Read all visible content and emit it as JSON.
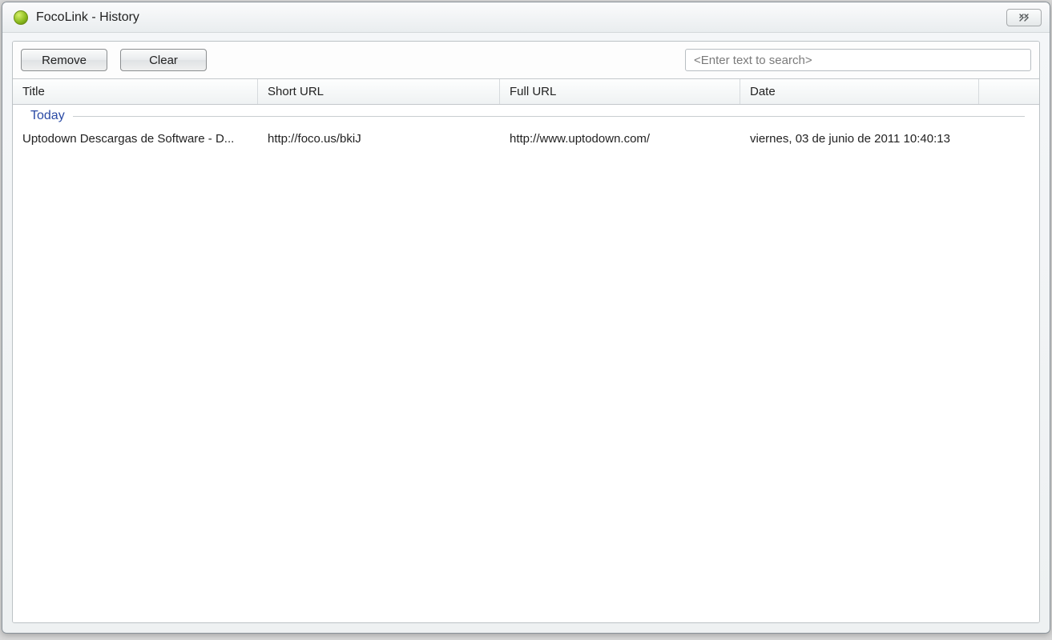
{
  "window": {
    "title": "FocoLink - History"
  },
  "toolbar": {
    "remove_label": "Remove",
    "clear_label": "Clear"
  },
  "search": {
    "placeholder": "<Enter text to search>"
  },
  "columns": {
    "title": "Title",
    "short_url": "Short URL",
    "full_url": "Full URL",
    "date": "Date"
  },
  "groups": [
    {
      "label": "Today",
      "rows": [
        {
          "title": "Uptodown Descargas de Software - D...",
          "short_url": "http://foco.us/bkiJ",
          "full_url": "http://www.uptodown.com/",
          "date": "viernes, 03 de junio de 2011 10:40:13"
        }
      ]
    }
  ]
}
